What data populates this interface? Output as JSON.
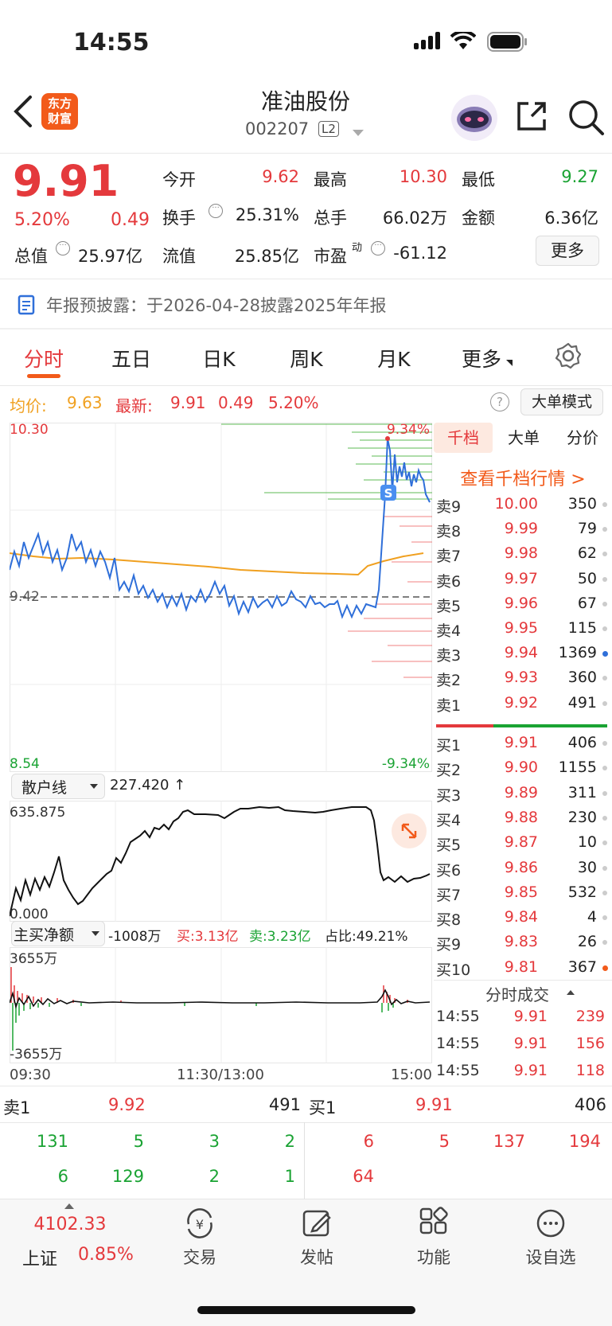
{
  "status": {
    "time": "14:55"
  },
  "header": {
    "brand_line1": "东方",
    "brand_line2": "财富",
    "stock_name": "准油股份",
    "stock_code": "002207",
    "l2_badge": "L2"
  },
  "quote": {
    "price": "9.91",
    "change_pct": "5.20%",
    "change": "0.49",
    "open_label": "今开",
    "open": "9.62",
    "high_label": "最高",
    "high": "10.30",
    "low_label": "最低",
    "low": "9.27",
    "turnover_label": "换手",
    "turnover": "25.31%",
    "volume_label": "总手",
    "volume": "66.02万",
    "amount_label": "金额",
    "amount": "6.36亿",
    "mktcap_label": "总值",
    "mktcap": "25.97亿",
    "float_label": "流值",
    "float_cap": "25.85亿",
    "pe_label": "市盈",
    "pe_sup": "动",
    "pe": "-61.12",
    "more_button": "更多"
  },
  "notice": {
    "text": "年报预披露：于2026-04-28披露2025年年报"
  },
  "tabs": [
    "分时",
    "五日",
    "日K",
    "周K",
    "月K",
    "更多"
  ],
  "intraday": {
    "avg_label": "均价:",
    "avg": "9.63",
    "latest_label": "最新:",
    "latest": "9.91",
    "latest_change": "0.49",
    "latest_pct": "5.20%",
    "mode_button": "大单模式",
    "y_high": "10.30",
    "y_mid": "9.42",
    "y_low": "8.54",
    "pct_high": "9.34%",
    "pct_low": "-9.34%",
    "s_marker": "S"
  },
  "order_panel": {
    "tabs": [
      "千档",
      "大单",
      "分价"
    ],
    "link": "查看千档行情 >",
    "asks": [
      {
        "label": "卖9",
        "price": "10.00",
        "vol": "350"
      },
      {
        "label": "卖8",
        "price": "9.99",
        "vol": "79"
      },
      {
        "label": "卖7",
        "price": "9.98",
        "vol": "62"
      },
      {
        "label": "卖6",
        "price": "9.97",
        "vol": "50"
      },
      {
        "label": "卖5",
        "price": "9.96",
        "vol": "67"
      },
      {
        "label": "卖4",
        "price": "9.95",
        "vol": "115"
      },
      {
        "label": "卖3",
        "price": "9.94",
        "vol": "1369"
      },
      {
        "label": "卖2",
        "price": "9.93",
        "vol": "360"
      },
      {
        "label": "卖1",
        "price": "9.92",
        "vol": "491"
      }
    ],
    "bids": [
      {
        "label": "买1",
        "price": "9.91",
        "vol": "406"
      },
      {
        "label": "买2",
        "price": "9.90",
        "vol": "1155"
      },
      {
        "label": "买3",
        "price": "9.89",
        "vol": "311"
      },
      {
        "label": "买4",
        "price": "9.88",
        "vol": "230"
      },
      {
        "label": "买5",
        "price": "9.87",
        "vol": "10"
      },
      {
        "label": "买6",
        "price": "9.86",
        "vol": "30"
      },
      {
        "label": "买7",
        "price": "9.85",
        "vol": "532"
      },
      {
        "label": "买8",
        "price": "9.84",
        "vol": "4"
      },
      {
        "label": "买9",
        "price": "9.83",
        "vol": "26"
      },
      {
        "label": "买10",
        "price": "9.81",
        "vol": "367"
      }
    ],
    "trades_title": "分时成交",
    "trades": [
      {
        "time": "14:55",
        "price": "9.91",
        "vol": "239"
      },
      {
        "time": "14:55",
        "price": "9.91",
        "vol": "156"
      },
      {
        "time": "14:55",
        "price": "9.91",
        "vol": "118"
      }
    ]
  },
  "retail": {
    "label": "散户线",
    "value": "227.420 ↑",
    "y_high": "635.875",
    "y_low": "0.000"
  },
  "netbuy": {
    "label": "主买净额",
    "value": "-1008万",
    "buy": "买:3.13亿",
    "sell": "卖:3.23亿",
    "ratio": "占比:49.21%",
    "y_high": "3655万",
    "y_low": "-3655万"
  },
  "time_axis": [
    "09:30",
    "11:30/13:00",
    "15:00"
  ],
  "level1": {
    "ask_label": "卖1",
    "ask_price": "9.92",
    "ask_vol": "491",
    "bid_label": "买1",
    "bid_price": "9.91",
    "bid_vol": "406",
    "ask_queue": [
      [
        "131",
        "5",
        "3",
        "2"
      ],
      [
        "6",
        "129",
        "2",
        "1"
      ]
    ],
    "bid_queue": [
      [
        "6",
        "5",
        "137",
        "194"
      ],
      [
        "64"
      ]
    ]
  },
  "bottom_nav": {
    "index_value": "4102.33",
    "index_name": "上证",
    "index_pct": "0.85%",
    "items": [
      "交易",
      "发帖",
      "功能",
      "设自选"
    ]
  }
}
